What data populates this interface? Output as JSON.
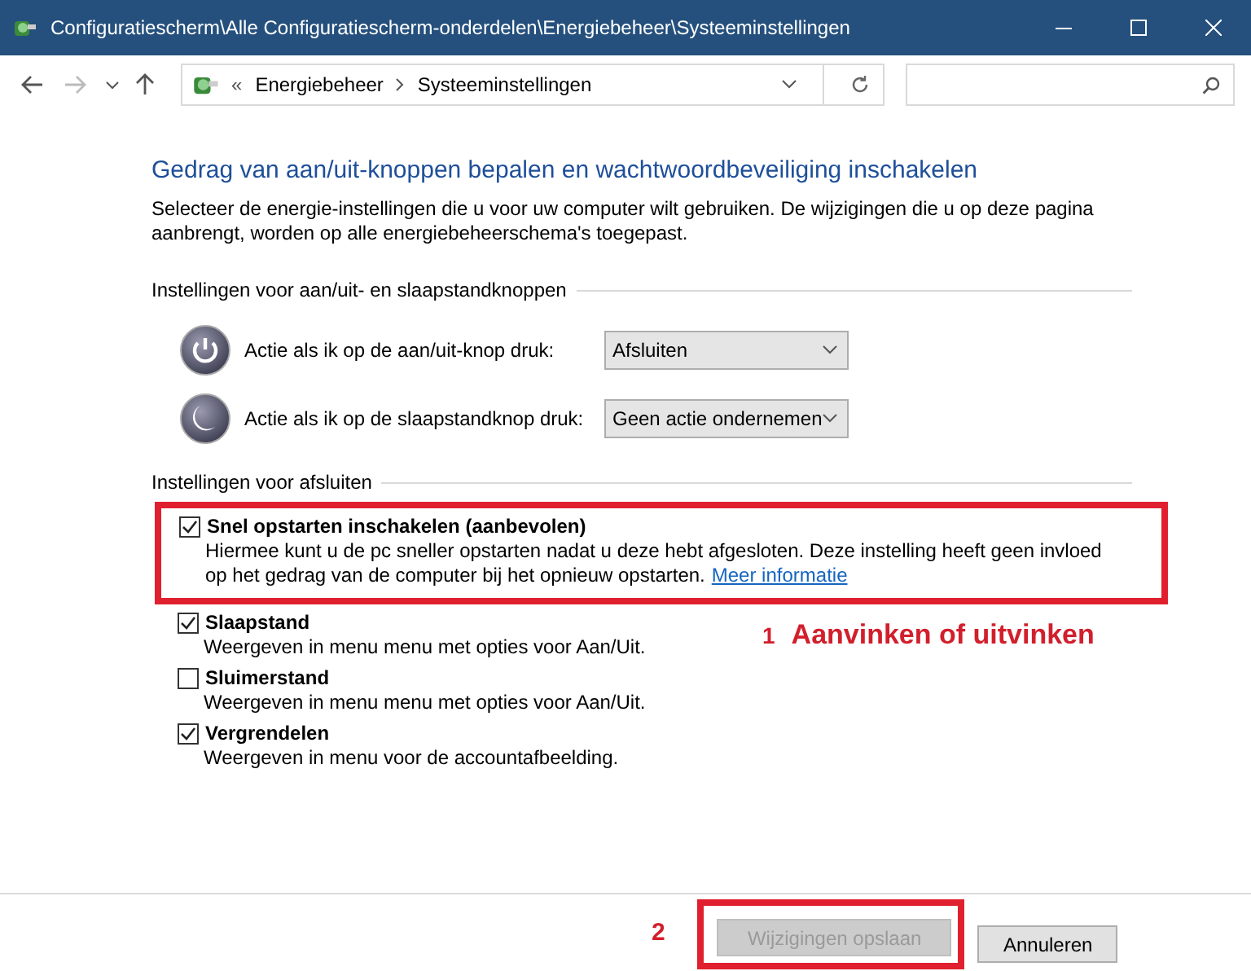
{
  "window": {
    "title": "Configuratiescherm\\Alle Configuratiescherm-onderdelen\\Energiebeheer\\Systeeminstellingen"
  },
  "nav_buttons": [
    {
      "kind": "back",
      "disabled": false
    },
    {
      "kind": "forward",
      "disabled": true
    },
    {
      "kind": "recent",
      "disabled": false
    },
    {
      "kind": "up",
      "disabled": false
    }
  ],
  "address": {
    "overflow": "«",
    "path": [
      "Energiebeheer",
      "Systeeminstellingen"
    ]
  },
  "heading": "Gedrag van aan/uit-knoppen bepalen en wachtwoordbeveiliging inschakelen",
  "description": "Selecteer de energie-instellingen die u voor uw computer wilt gebruiken. De wijzigingen die u op deze pagina aanbrengt, worden op alle energiebeheerschema's toegepast.",
  "button_section": {
    "title": "Instellingen voor aan/uit- en slaapstandknoppen",
    "rows": [
      {
        "kind": "power",
        "label": "Actie als ik op de aan/uit-knop druk:",
        "value": "Afsluiten"
      },
      {
        "kind": "sleep",
        "label": "Actie als ik op de slaapstandknop druk:",
        "value": "Geen actie ondernemen"
      }
    ]
  },
  "shutdown_section": {
    "title": "Instellingen voor afsluiten",
    "options": [
      {
        "label": "Snel opstarten inschakelen (aanbevolen)",
        "description": "Hiermee kunt u de pc sneller opstarten nadat u deze hebt afgesloten. Deze instelling heeft geen invloed op het gedrag van de computer bij het opnieuw opstarten.",
        "link": "Meer informatie",
        "checked": true,
        "highlighted": true,
        "callout": {
          "number": "1",
          "text": "Aanvinken of uitvinken"
        }
      },
      {
        "label": "Slaapstand",
        "description": "Weergeven in menu menu met opties voor Aan/Uit.",
        "checked": true,
        "highlighted": false
      },
      {
        "label": "Sluimerstand",
        "description": "Weergeven in menu menu met opties voor Aan/Uit.",
        "checked": false,
        "highlighted": false
      },
      {
        "label": "Vergrendelen",
        "description": "Weergeven in menu voor de accountafbeelding.",
        "checked": true,
        "highlighted": false
      }
    ]
  },
  "footer": {
    "buttons": [
      {
        "label": "Wijzigingen opslaan",
        "disabled": true,
        "highlighted": true,
        "callout": {
          "number": "2"
        }
      },
      {
        "label": "Annuleren",
        "disabled": false,
        "highlighted": false
      }
    ]
  }
}
